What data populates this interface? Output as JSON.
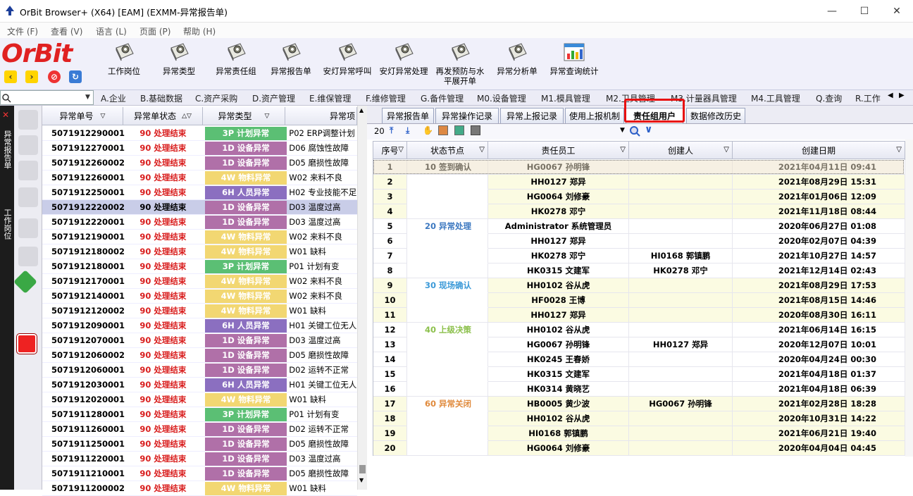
{
  "window": {
    "title": "OrBit Browser+ (X64) [EAM] (EXMM-异常报告单)"
  },
  "menu": [
    "文件 (F)",
    "查看 (V)",
    "语言 (L)",
    "页面 (P)",
    "帮助 (H)"
  ],
  "logo": "OrBit",
  "toolbar": [
    {
      "label": "工作岗位"
    },
    {
      "label": "异常类型"
    },
    {
      "label": "异常责任组"
    },
    {
      "label": "异常报告单"
    },
    {
      "label": "安灯异常呼叫"
    },
    {
      "label": "安灯异常处理"
    },
    {
      "label": "再发预防与水平展开单"
    },
    {
      "label": "异常分析单"
    },
    {
      "label": "异常查询统计"
    }
  ],
  "modules": [
    "A.企业",
    "B.基础数据",
    "C.资产采购",
    "D.资产管理",
    "E.维保管理",
    "F.维修管理",
    "G.备件管理",
    "M0.设备管理",
    "M1.模具管理",
    "M2.卫具管理",
    "M3.计量器具管理",
    "M4.工具管理",
    "Q.查询",
    "R.工作"
  ],
  "side_labels": {
    "top": "异常报告单",
    "bottom": "工作岗位"
  },
  "left_grid": {
    "headers": [
      "异常单号",
      "异常单状态",
      "异常类型",
      "异常项"
    ],
    "rows": [
      {
        "no": "5071912290001",
        "status": "90 处理结束",
        "type": "3P 计划异常",
        "item": "P02 ERP调整计划"
      },
      {
        "no": "5071912270001",
        "status": "90 处理结束",
        "type": "1D 设备异常",
        "item": "D06 腐蚀性故障"
      },
      {
        "no": "5071912260002",
        "status": "90 处理结束",
        "type": "1D 设备异常",
        "item": "D05 磨损性故障"
      },
      {
        "no": "5071912260001",
        "status": "90 处理结束",
        "type": "4W 物料异常",
        "item": "W02 来料不良"
      },
      {
        "no": "5071912250001",
        "status": "90 处理结束",
        "type": "6H 人员异常",
        "item": "H02 专业技能不足"
      },
      {
        "no": "5071912220002",
        "status": "90 处理结束",
        "type": "1D 设备异常",
        "item": "D03 温度过高",
        "selected": true
      },
      {
        "no": "5071912220001",
        "status": "90 处理结束",
        "type": "1D 设备异常",
        "item": "D03 温度过高"
      },
      {
        "no": "5071912190001",
        "status": "90 处理结束",
        "type": "4W 物料异常",
        "item": "W02 来料不良"
      },
      {
        "no": "5071912180002",
        "status": "90 处理结束",
        "type": "4W 物料异常",
        "item": "W01 缺料"
      },
      {
        "no": "5071912180001",
        "status": "90 处理结束",
        "type": "3P 计划异常",
        "item": "P01 计划有变"
      },
      {
        "no": "5071912170001",
        "status": "90 处理结束",
        "type": "4W 物料异常",
        "item": "W02 来料不良"
      },
      {
        "no": "5071912140001",
        "status": "90 处理结束",
        "type": "4W 物料异常",
        "item": "W02 来料不良"
      },
      {
        "no": "5071912120002",
        "status": "90 处理结束",
        "type": "4W 物料异常",
        "item": "W01 缺料"
      },
      {
        "no": "5071912090001",
        "status": "90 处理结束",
        "type": "6H 人员异常",
        "item": "H01 关键工位无人"
      },
      {
        "no": "5071912070001",
        "status": "90 处理结束",
        "type": "1D 设备异常",
        "item": "D03 温度过高"
      },
      {
        "no": "5071912060002",
        "status": "90 处理结束",
        "type": "1D 设备异常",
        "item": "D05 磨损性故障"
      },
      {
        "no": "5071912060001",
        "status": "90 处理结束",
        "type": "1D 设备异常",
        "item": "D02 运转不正常"
      },
      {
        "no": "5071912030001",
        "status": "90 处理结束",
        "type": "6H 人员异常",
        "item": "H01 关键工位无人"
      },
      {
        "no": "5071912020001",
        "status": "90 处理结束",
        "type": "4W 物料异常",
        "item": "W01 缺料"
      },
      {
        "no": "5071911280001",
        "status": "90 处理结束",
        "type": "3P 计划异常",
        "item": "P01 计划有变"
      },
      {
        "no": "5071911260001",
        "status": "90 处理结束",
        "type": "1D 设备异常",
        "item": "D02 运转不正常"
      },
      {
        "no": "5071911250001",
        "status": "90 处理结束",
        "type": "1D 设备异常",
        "item": "D05 磨损性故障"
      },
      {
        "no": "5071911220001",
        "status": "90 处理结束",
        "type": "1D 设备异常",
        "item": "D03 温度过高"
      },
      {
        "no": "5071911210001",
        "status": "90 处理结束",
        "type": "1D 设备异常",
        "item": "D05 磨损性故障"
      },
      {
        "no": "5071911200002",
        "status": "90 处理结束",
        "type": "4W 物料异常",
        "item": "W01 缺料"
      }
    ]
  },
  "type_colors": {
    "3P": "#5bbf74",
    "1D": "#b070a8",
    "4W": "#f2d772",
    "6H": "#8b6fc0"
  },
  "tabs": [
    "异常报告单",
    "异常操作记录",
    "异常上报记录",
    "使用上报机制",
    "责任组用户",
    "数据修改历史"
  ],
  "active_tab": "责任组用户",
  "page_size": "20",
  "right_grid": {
    "headers": [
      "序号",
      "状态节点",
      "责任员工",
      "创建人",
      "创建日期"
    ],
    "rows": [
      {
        "seq": "1",
        "node": "10 签到确认",
        "emp": "HG0067 孙明锋",
        "creator": "",
        "date": "2021年04月11日  09:41"
      },
      {
        "seq": "2",
        "node": "",
        "emp": "HH0127 郑异",
        "creator": "",
        "date": "2021年08月29日  15:31"
      },
      {
        "seq": "3",
        "node": "",
        "emp": "HG0064 刘修豪",
        "creator": "",
        "date": "2021年01月06日  12:09"
      },
      {
        "seq": "4",
        "node": "",
        "emp": "HK0278 邓宁",
        "creator": "",
        "date": "2021年11月18日  08:44"
      },
      {
        "seq": "5",
        "node": "20 异常处理",
        "emp": "Administrator 系统管理员",
        "creator": "",
        "date": "2020年06月27日  01:08"
      },
      {
        "seq": "6",
        "node": "",
        "emp": "HH0127 郑异",
        "creator": "",
        "date": "2020年02月07日  04:39"
      },
      {
        "seq": "7",
        "node": "",
        "emp": "HK0278 邓宁",
        "creator": "HI0168 郭镇鹏",
        "date": "2021年10月27日  14:57"
      },
      {
        "seq": "8",
        "node": "",
        "emp": "HK0315 文建军",
        "creator": "HK0278 邓宁",
        "date": "2021年12月14日  02:43"
      },
      {
        "seq": "9",
        "node": "30 现场确认",
        "emp": "HH0102 谷从虎",
        "creator": "",
        "date": "2021年08月29日  17:53"
      },
      {
        "seq": "10",
        "node": "",
        "emp": "HF0028 王博",
        "creator": "",
        "date": "2021年08月15日  14:46"
      },
      {
        "seq": "11",
        "node": "",
        "emp": "HH0127 郑异",
        "creator": "",
        "date": "2020年08月30日  16:11"
      },
      {
        "seq": "12",
        "node": "40 上级决策",
        "emp": "HH0102 谷从虎",
        "creator": "",
        "date": "2021年06月14日  16:15"
      },
      {
        "seq": "13",
        "node": "",
        "emp": "HG0067 孙明锋",
        "creator": "HH0127 郑异",
        "date": "2020年12月07日  10:01"
      },
      {
        "seq": "14",
        "node": "",
        "emp": "HK0245 王春娇",
        "creator": "",
        "date": "2020年04月24日  00:30"
      },
      {
        "seq": "15",
        "node": "",
        "emp": "HK0315 文建军",
        "creator": "",
        "date": "2021年04月18日  01:37"
      },
      {
        "seq": "16",
        "node": "",
        "emp": "HK0314 黄晓艺",
        "creator": "",
        "date": "2021年04月18日  06:39"
      },
      {
        "seq": "17",
        "node": "60 异常关闭",
        "emp": "HB0005 黄少波",
        "creator": "HG0067 孙明锋",
        "date": "2021年02月28日  18:28"
      },
      {
        "seq": "18",
        "node": "",
        "emp": "HH0102 谷从虎",
        "creator": "",
        "date": "2020年10月31日  14:22"
      },
      {
        "seq": "19",
        "node": "",
        "emp": "HI0168 郭镇鹏",
        "creator": "",
        "date": "2021年06月21日  19:40"
      },
      {
        "seq": "20",
        "node": "",
        "emp": "HG0064 刘修豪",
        "creator": "",
        "date": "2020年04月04日  04:45"
      }
    ],
    "node_colors": {
      "10": "#000000",
      "20": "#3c78c0",
      "30": "#3c9ad8",
      "40": "#8cc04c",
      "60": "#e08a3c"
    }
  }
}
